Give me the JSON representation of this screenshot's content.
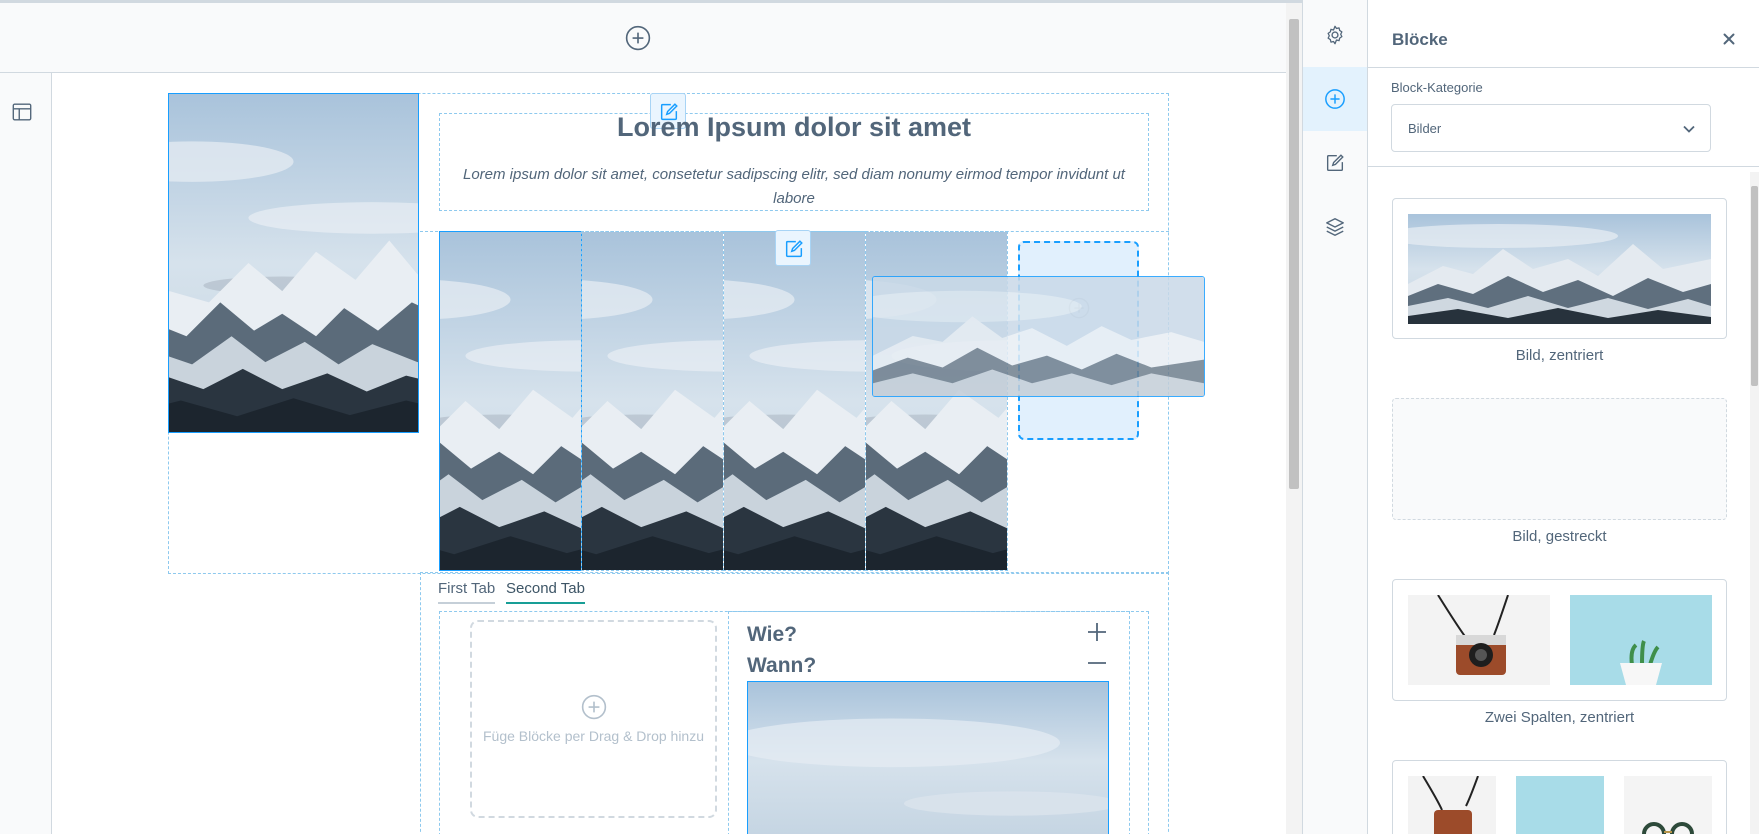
{
  "editor": {
    "top_add_icon": "plus-circle-icon",
    "gutter_icon": "layout-icon",
    "text_block": {
      "title": "Lorem Ipsum dolor sit amet",
      "body": "Lorem ipsum dolor sit amet, consetetur sadipscing elitr, sed diam nonumy eirmod tempor invidunt ut labore"
    },
    "tabs": [
      {
        "label": "First Tab",
        "active": false
      },
      {
        "label": "Second Tab",
        "active": true
      }
    ],
    "dropzone_text": "Füge Blöcke per Drag & Drop hinzu",
    "accordion": {
      "items": [
        "Wie?",
        "Wann?"
      ],
      "expand_icon": "plus-icon",
      "collapse_icon": "minus-icon"
    }
  },
  "sidebar": {
    "nav": [
      {
        "name": "settings",
        "icon": "gear-icon",
        "active": false
      },
      {
        "name": "add-blocks",
        "icon": "plus-circle-icon",
        "active": true
      },
      {
        "name": "edit",
        "icon": "edit-icon",
        "active": false
      },
      {
        "name": "layers",
        "icon": "layers-icon",
        "active": false
      }
    ],
    "panel": {
      "title": "Blöcke",
      "close_icon": "close-icon",
      "category_label": "Block-Kategorie",
      "category_value": "Bilder",
      "blocks": [
        {
          "label": "Bild, zentriert"
        },
        {
          "label": "Bild, gestreckt"
        },
        {
          "label": "Zwei Spalten, zentriert"
        },
        {
          "label": ""
        }
      ]
    }
  },
  "colors": {
    "accent": "#189eff",
    "text": "#52667a",
    "border": "#d1d9e0",
    "drop_bg": "#e1f0fd",
    "tab_active": "#189e96"
  }
}
